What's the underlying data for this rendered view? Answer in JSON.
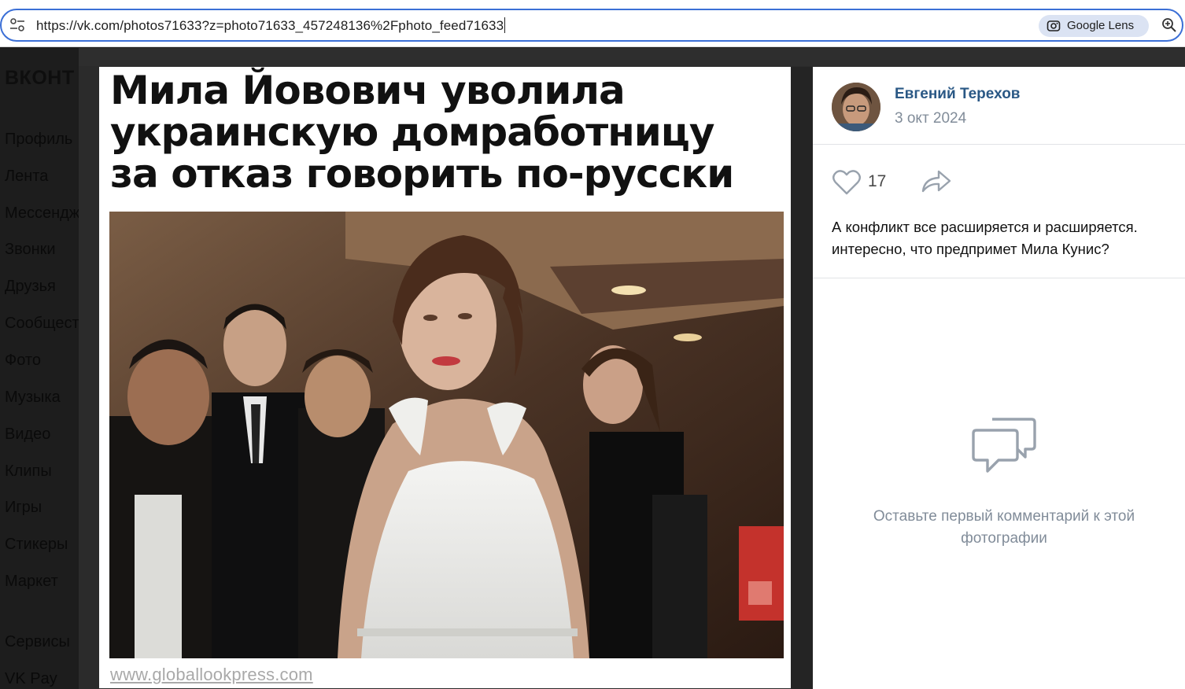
{
  "browser": {
    "url": "https://vk.com/photos71633?z=photo71633_457248136%2Fphoto_feed71633",
    "lens_label": "Google Lens"
  },
  "sidebar": {
    "logo": "ВКОНТ",
    "items": [
      {
        "label": "Профиль"
      },
      {
        "label": "Лента"
      },
      {
        "label": "Мессендж"
      },
      {
        "label": "Звонки"
      },
      {
        "label": "Друзья"
      },
      {
        "label": "Сообщест"
      },
      {
        "label": "Фото"
      },
      {
        "label": "Музыка"
      },
      {
        "label": "Видео"
      },
      {
        "label": "Клипы"
      },
      {
        "label": "Игры"
      },
      {
        "label": "Стикеры"
      },
      {
        "label": "Маркет"
      },
      {
        "label": "Сервисы"
      },
      {
        "label": "VK Pay"
      }
    ]
  },
  "photo": {
    "headline_lines": [
      "Мила Йовович уволила",
      "украинскую домработницу",
      "за отказ говорить по-русски"
    ],
    "watermark": "www.globallookpress.com"
  },
  "post": {
    "author": "Евгений Терехов",
    "date": "3 окт 2024",
    "likes": "17",
    "caption": "А конфликт все расширяется и расширяется. интересно, что предпримет Мила Кунис?",
    "empty_comments": "Оставьте первый комментарий к этой фотографии"
  },
  "colors": {
    "author_link": "#2a5885",
    "muted_text": "#818c99",
    "omnibox_border": "#3b6fd6",
    "lens_chip": "#dbe3f3"
  }
}
